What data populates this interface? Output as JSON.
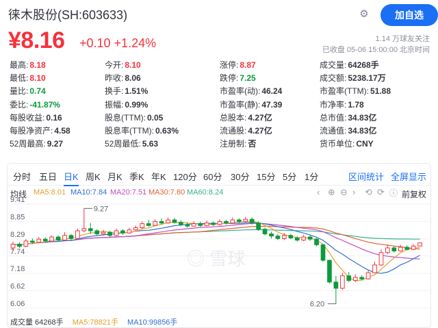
{
  "header": {
    "title": "徕木股份(SH:603633)",
    "follow_label": "加自选"
  },
  "quote": {
    "price": "¥8.16",
    "change": "+0.10 +1.24%",
    "followers": "1.14 万球友关注",
    "timestamp": "已收盘 05-06 15:00:00 北京时间"
  },
  "stats": [
    [
      {
        "k": "最高:",
        "v": "8.18",
        "c": "red"
      },
      {
        "k": "今开:",
        "v": "8.10",
        "c": "red"
      },
      {
        "k": "涨停:",
        "v": "8.87",
        "c": "red"
      },
      {
        "k": "成交量:",
        "v": "64268手",
        "c": "dark"
      }
    ],
    [
      {
        "k": "最低:",
        "v": "8.10",
        "c": "red"
      },
      {
        "k": "昨收:",
        "v": "8.06",
        "c": "dark"
      },
      {
        "k": "跌停:",
        "v": "7.25",
        "c": "green"
      },
      {
        "k": "成交额:",
        "v": "5238.17万",
        "c": "dark"
      }
    ],
    [
      {
        "k": "量比:",
        "v": "0.74",
        "c": "green"
      },
      {
        "k": "换手:",
        "v": "1.51%",
        "c": "dark"
      },
      {
        "k": "市盈率(动):",
        "v": "46.24",
        "c": "dark"
      },
      {
        "k": "市盈率(TTM):",
        "v": "51.88",
        "c": "dark"
      }
    ],
    [
      {
        "k": "委比:",
        "v": "-41.87%",
        "c": "green"
      },
      {
        "k": "振幅:",
        "v": "0.99%",
        "c": "dark"
      },
      {
        "k": "市盈率(静):",
        "v": "47.39",
        "c": "dark"
      },
      {
        "k": "市净率:",
        "v": "1.78",
        "c": "dark"
      }
    ],
    [
      {
        "k": "每股收益:",
        "v": "0.16",
        "c": "dark"
      },
      {
        "k": "股息(TTM):",
        "v": "0.05",
        "c": "dark"
      },
      {
        "k": "总股本:",
        "v": "4.27亿",
        "c": "dark"
      },
      {
        "k": "总市值:",
        "v": "34.83亿",
        "c": "dark"
      }
    ],
    [
      {
        "k": "每股净资产:",
        "v": "4.58",
        "c": "dark"
      },
      {
        "k": "股息率(TTM):",
        "v": "0.63%",
        "c": "dark"
      },
      {
        "k": "流通股:",
        "v": "4.27亿",
        "c": "dark"
      },
      {
        "k": "流通值:",
        "v": "34.83亿",
        "c": "dark"
      }
    ],
    [
      {
        "k": "52周最高:",
        "v": "9.27",
        "c": "dark"
      },
      {
        "k": "52周最低:",
        "v": "5.63",
        "c": "dark"
      },
      {
        "k": "注册制:",
        "v": "否",
        "c": "dark"
      },
      {
        "k": "货币单位:",
        "v": "CNY",
        "c": "dark"
      }
    ]
  ],
  "tabs": [
    "分时",
    "五日",
    "日K",
    "周K",
    "月K",
    "季K",
    "年K",
    "120分",
    "60分",
    "30分",
    "15分",
    "5分",
    "1分"
  ],
  "active_tab": "日K",
  "tab_right": [
    "区间统计",
    "全屏显示"
  ],
  "legend": {
    "label": "均线",
    "ma5": "MA5:8.01",
    "ma10": "MA10:7.84",
    "ma20": "MA20:7.51",
    "ma30": "MA30:7.80",
    "ma60": "MA60:8.24",
    "adjust": "前复权"
  },
  "watermark": "雪球",
  "volume": {
    "label": "成交量 64268手",
    "ma5": "MA5:78821手",
    "ma10": "MA10:99856手"
  },
  "colors": {
    "up": "#f5323c",
    "down": "#0c9a3c",
    "accent": "#1b6ff5",
    "ma5": "#e4a12a",
    "ma10": "#2f6fd0",
    "ma20": "#c24ac4",
    "ma30": "#e06233",
    "ma60": "#35b18f"
  },
  "chart_data": {
    "type": "candlestick",
    "y_ticks": [
      "9.41",
      "8.85",
      "8.29",
      "7.74",
      "7.18",
      "6.62",
      "6.06"
    ],
    "ylim": [
      6.06,
      9.41
    ],
    "annotations": [
      {
        "label": "9.27",
        "value": 9.27
      },
      {
        "label": "6.20",
        "value": 6.2
      }
    ],
    "candles": [
      [
        8.0,
        8.12,
        8.2,
        7.9
      ],
      [
        8.12,
        8.05,
        8.18,
        8.0
      ],
      [
        8.05,
        8.22,
        8.28,
        8.02
      ],
      [
        8.22,
        8.18,
        8.3,
        8.12
      ],
      [
        8.18,
        8.28,
        8.35,
        8.15
      ],
      [
        8.28,
        8.22,
        8.34,
        8.18
      ],
      [
        8.22,
        8.35,
        8.4,
        8.2
      ],
      [
        8.35,
        8.25,
        8.4,
        8.2
      ],
      [
        8.25,
        8.4,
        8.5,
        8.24
      ],
      [
        8.4,
        8.3,
        8.45,
        8.25
      ],
      [
        8.3,
        8.55,
        8.62,
        8.28
      ],
      [
        8.55,
        8.62,
        9.27,
        8.5
      ],
      [
        8.62,
        8.55,
        8.8,
        8.45
      ],
      [
        8.55,
        8.45,
        8.6,
        8.4
      ],
      [
        8.45,
        8.5,
        8.58,
        8.4
      ],
      [
        8.5,
        8.4,
        8.55,
        8.35
      ],
      [
        8.4,
        8.55,
        8.62,
        8.38
      ],
      [
        8.55,
        8.48,
        8.6,
        8.42
      ],
      [
        8.48,
        8.58,
        8.65,
        8.45
      ],
      [
        8.58,
        8.65,
        8.72,
        8.55
      ],
      [
        8.65,
        8.78,
        8.85,
        8.6
      ],
      [
        8.78,
        8.72,
        8.9,
        8.68
      ],
      [
        8.72,
        8.85,
        8.92,
        8.7
      ],
      [
        8.85,
        8.8,
        8.95,
        8.75
      ],
      [
        8.8,
        8.9,
        8.98,
        8.78
      ],
      [
        8.9,
        8.82,
        8.96,
        8.78
      ],
      [
        8.82,
        8.75,
        8.88,
        8.7
      ],
      [
        8.75,
        8.7,
        8.82,
        8.65
      ],
      [
        8.7,
        8.78,
        8.85,
        8.68
      ],
      [
        8.78,
        8.72,
        8.84,
        8.68
      ],
      [
        8.72,
        8.8,
        8.88,
        8.7
      ],
      [
        8.8,
        8.75,
        8.85,
        8.7
      ],
      [
        8.75,
        8.85,
        8.92,
        8.72
      ],
      [
        8.85,
        8.8,
        8.9,
        8.75
      ],
      [
        8.8,
        8.9,
        8.98,
        8.78
      ],
      [
        8.9,
        8.85,
        8.95,
        8.8
      ],
      [
        8.85,
        8.92,
        9.0,
        8.82
      ],
      [
        8.92,
        8.8,
        8.98,
        8.75
      ],
      [
        8.8,
        8.6,
        8.85,
        8.55
      ],
      [
        8.6,
        8.45,
        8.65,
        8.4
      ],
      [
        8.45,
        8.38,
        8.52,
        8.3
      ],
      [
        8.38,
        8.3,
        8.45,
        8.25
      ],
      [
        8.3,
        8.4,
        8.48,
        8.25
      ],
      [
        8.4,
        8.32,
        8.45,
        8.28
      ],
      [
        8.32,
        8.25,
        8.38,
        8.2
      ],
      [
        8.25,
        8.35,
        8.42,
        8.22
      ],
      [
        8.35,
        8.28,
        8.4,
        8.22
      ],
      [
        8.28,
        8.1,
        8.32,
        8.05
      ],
      [
        8.1,
        7.6,
        8.12,
        7.55
      ],
      [
        7.6,
        6.9,
        7.62,
        6.85
      ],
      [
        6.9,
        6.7,
        7.1,
        6.2
      ],
      [
        6.7,
        7.1,
        7.2,
        6.65
      ],
      [
        7.1,
        6.95,
        7.22,
        6.9
      ],
      [
        6.95,
        7.05,
        7.15,
        6.9
      ],
      [
        7.05,
        7.0,
        7.12,
        6.95
      ],
      [
        7.0,
        7.2,
        7.28,
        6.98
      ],
      [
        7.2,
        7.45,
        7.55,
        7.18
      ],
      [
        7.45,
        7.85,
        7.95,
        7.42
      ],
      [
        7.85,
        8.0,
        8.1,
        7.8
      ],
      [
        8.0,
        7.9,
        8.06,
        7.85
      ],
      [
        7.9,
        8.02,
        8.1,
        7.88
      ],
      [
        8.02,
        7.95,
        8.08,
        7.92
      ],
      [
        7.95,
        8.06,
        8.12,
        7.92
      ],
      [
        8.06,
        8.16,
        8.18,
        8.1
      ]
    ]
  }
}
